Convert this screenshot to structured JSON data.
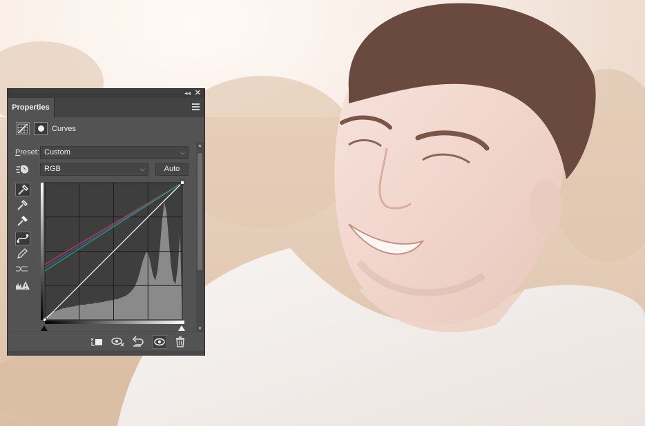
{
  "panel": {
    "tab_label": "Properties",
    "adjustment_title": "Curves",
    "preset_label": "Preset:",
    "preset_label_access_key": "P",
    "preset_label_rest": "reset:",
    "preset_value": "Custom",
    "channel_value": "RGB",
    "auto_label": "Auto",
    "icons": {
      "collapse": "double-chevron-left-icon",
      "close": "close-icon",
      "menu": "hamburger-menu-icon",
      "adjustment": "curves-adjustment-icon",
      "mask": "layer-mask-icon",
      "hand": "on-image-adjust-icon",
      "black_point": "black-point-eyedropper-icon",
      "gray_point": "gray-point-eyedropper-icon",
      "white_point": "white-point-eyedropper-icon",
      "curve": "edit-points-curve-icon",
      "pencil": "draw-pencil-icon",
      "smooth": "smooth-curve-icon",
      "clipping": "show-clipping-warning-icon",
      "clip": "clip-to-layer-icon",
      "view_previous": "view-previous-state-icon",
      "reset": "reset-icon",
      "visibility": "eye-visibility-icon",
      "delete": "trash-icon"
    }
  },
  "colors": {
    "red_curve": "#c23a3a",
    "blue_curve": "#3b4fc8",
    "green_curve": "#2e9a4a",
    "composite_curve": "#ffffff",
    "panel_bg": "#535353"
  },
  "curves": {
    "red": [
      [
        0,
        103
      ],
      [
        255,
        255
      ]
    ],
    "blue": [
      [
        0,
        97
      ],
      [
        255,
        255
      ]
    ],
    "green": [
      [
        0,
        91
      ],
      [
        255,
        255
      ]
    ],
    "rgb": [
      [
        0,
        0
      ],
      [
        255,
        255
      ]
    ]
  },
  "histogram": [
    3,
    4,
    6,
    8,
    9,
    10,
    11,
    12,
    13,
    13,
    14,
    14,
    15,
    15,
    16,
    16,
    17,
    17,
    17,
    18,
    18,
    18,
    19,
    19,
    19,
    20,
    20,
    21,
    21,
    22,
    22,
    23,
    23,
    24,
    25,
    26,
    27,
    29,
    31,
    34,
    38,
    44,
    52,
    62,
    70,
    76,
    74,
    62,
    50,
    44,
    55,
    80,
    110,
    132,
    120,
    90,
    60,
    44,
    40,
    60,
    95,
    3
  ]
}
